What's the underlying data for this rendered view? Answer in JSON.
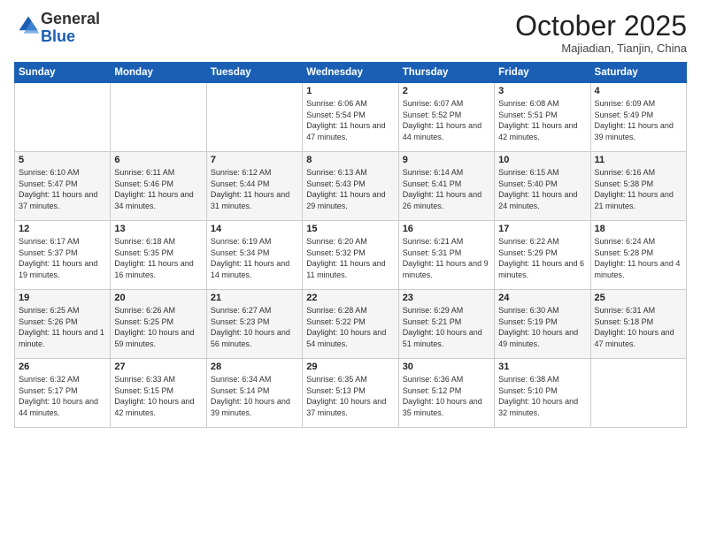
{
  "logo": {
    "general": "General",
    "blue": "Blue"
  },
  "header": {
    "month": "October 2025",
    "location": "Majiadian, Tianjin, China"
  },
  "weekdays": [
    "Sunday",
    "Monday",
    "Tuesday",
    "Wednesday",
    "Thursday",
    "Friday",
    "Saturday"
  ],
  "weeks": [
    [
      null,
      null,
      null,
      {
        "day": 1,
        "sunrise": "6:06 AM",
        "sunset": "5:54 PM",
        "daylight": "11 hours and 47 minutes."
      },
      {
        "day": 2,
        "sunrise": "6:07 AM",
        "sunset": "5:52 PM",
        "daylight": "11 hours and 44 minutes."
      },
      {
        "day": 3,
        "sunrise": "6:08 AM",
        "sunset": "5:51 PM",
        "daylight": "11 hours and 42 minutes."
      },
      {
        "day": 4,
        "sunrise": "6:09 AM",
        "sunset": "5:49 PM",
        "daylight": "11 hours and 39 minutes."
      }
    ],
    [
      {
        "day": 5,
        "sunrise": "6:10 AM",
        "sunset": "5:47 PM",
        "daylight": "11 hours and 37 minutes."
      },
      {
        "day": 6,
        "sunrise": "6:11 AM",
        "sunset": "5:46 PM",
        "daylight": "11 hours and 34 minutes."
      },
      {
        "day": 7,
        "sunrise": "6:12 AM",
        "sunset": "5:44 PM",
        "daylight": "11 hours and 31 minutes."
      },
      {
        "day": 8,
        "sunrise": "6:13 AM",
        "sunset": "5:43 PM",
        "daylight": "11 hours and 29 minutes."
      },
      {
        "day": 9,
        "sunrise": "6:14 AM",
        "sunset": "5:41 PM",
        "daylight": "11 hours and 26 minutes."
      },
      {
        "day": 10,
        "sunrise": "6:15 AM",
        "sunset": "5:40 PM",
        "daylight": "11 hours and 24 minutes."
      },
      {
        "day": 11,
        "sunrise": "6:16 AM",
        "sunset": "5:38 PM",
        "daylight": "11 hours and 21 minutes."
      }
    ],
    [
      {
        "day": 12,
        "sunrise": "6:17 AM",
        "sunset": "5:37 PM",
        "daylight": "11 hours and 19 minutes."
      },
      {
        "day": 13,
        "sunrise": "6:18 AM",
        "sunset": "5:35 PM",
        "daylight": "11 hours and 16 minutes."
      },
      {
        "day": 14,
        "sunrise": "6:19 AM",
        "sunset": "5:34 PM",
        "daylight": "11 hours and 14 minutes."
      },
      {
        "day": 15,
        "sunrise": "6:20 AM",
        "sunset": "5:32 PM",
        "daylight": "11 hours and 11 minutes."
      },
      {
        "day": 16,
        "sunrise": "6:21 AM",
        "sunset": "5:31 PM",
        "daylight": "11 hours and 9 minutes."
      },
      {
        "day": 17,
        "sunrise": "6:22 AM",
        "sunset": "5:29 PM",
        "daylight": "11 hours and 6 minutes."
      },
      {
        "day": 18,
        "sunrise": "6:24 AM",
        "sunset": "5:28 PM",
        "daylight": "11 hours and 4 minutes."
      }
    ],
    [
      {
        "day": 19,
        "sunrise": "6:25 AM",
        "sunset": "5:26 PM",
        "daylight": "11 hours and 1 minute."
      },
      {
        "day": 20,
        "sunrise": "6:26 AM",
        "sunset": "5:25 PM",
        "daylight": "10 hours and 59 minutes."
      },
      {
        "day": 21,
        "sunrise": "6:27 AM",
        "sunset": "5:23 PM",
        "daylight": "10 hours and 56 minutes."
      },
      {
        "day": 22,
        "sunrise": "6:28 AM",
        "sunset": "5:22 PM",
        "daylight": "10 hours and 54 minutes."
      },
      {
        "day": 23,
        "sunrise": "6:29 AM",
        "sunset": "5:21 PM",
        "daylight": "10 hours and 51 minutes."
      },
      {
        "day": 24,
        "sunrise": "6:30 AM",
        "sunset": "5:19 PM",
        "daylight": "10 hours and 49 minutes."
      },
      {
        "day": 25,
        "sunrise": "6:31 AM",
        "sunset": "5:18 PM",
        "daylight": "10 hours and 47 minutes."
      }
    ],
    [
      {
        "day": 26,
        "sunrise": "6:32 AM",
        "sunset": "5:17 PM",
        "daylight": "10 hours and 44 minutes."
      },
      {
        "day": 27,
        "sunrise": "6:33 AM",
        "sunset": "5:15 PM",
        "daylight": "10 hours and 42 minutes."
      },
      {
        "day": 28,
        "sunrise": "6:34 AM",
        "sunset": "5:14 PM",
        "daylight": "10 hours and 39 minutes."
      },
      {
        "day": 29,
        "sunrise": "6:35 AM",
        "sunset": "5:13 PM",
        "daylight": "10 hours and 37 minutes."
      },
      {
        "day": 30,
        "sunrise": "6:36 AM",
        "sunset": "5:12 PM",
        "daylight": "10 hours and 35 minutes."
      },
      {
        "day": 31,
        "sunrise": "6:38 AM",
        "sunset": "5:10 PM",
        "daylight": "10 hours and 32 minutes."
      },
      null
    ]
  ],
  "labels": {
    "sunrise": "Sunrise:",
    "sunset": "Sunset:",
    "daylight": "Daylight:"
  }
}
